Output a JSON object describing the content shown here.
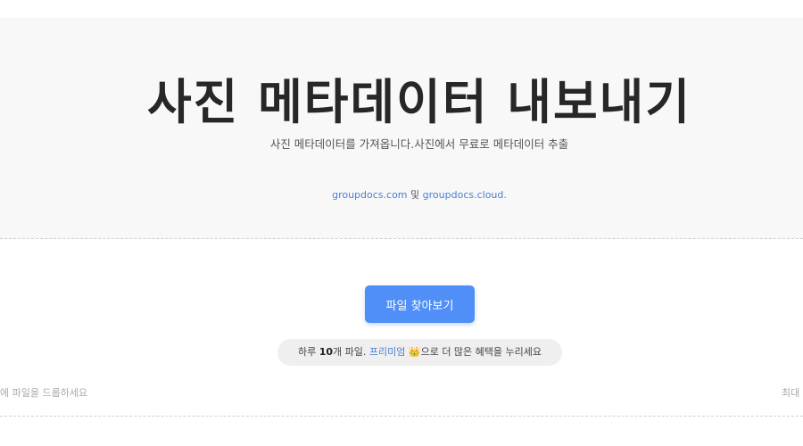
{
  "hero": {
    "title": "사진 메타데이터 내보내기",
    "subtitle": "사진 메타데이터를 가져옵니다.사진에서 무료로 메타데이터 추출",
    "link_groupdocs_com": "groupdocs.com",
    "link_connector": " 및 ",
    "link_groupdocs_cloud": "groupdocs.cloud."
  },
  "upload": {
    "browse_label": "파일 찾아보기",
    "limit_prefix": "하루 ",
    "limit_count": "10",
    "limit_unit": "개 파일. ",
    "premium_label": "프리미엄",
    "crown_glyph": "👑",
    "limit_suffix": "으로 더 많은 혜택을 누리세요",
    "drop_hint": "에 파일을 드롭하세요",
    "max_hint": "최대"
  },
  "colors": {
    "accent": "#4f8ff7",
    "link": "#4a7fd4",
    "hero_bg": "#f8f8f8"
  }
}
